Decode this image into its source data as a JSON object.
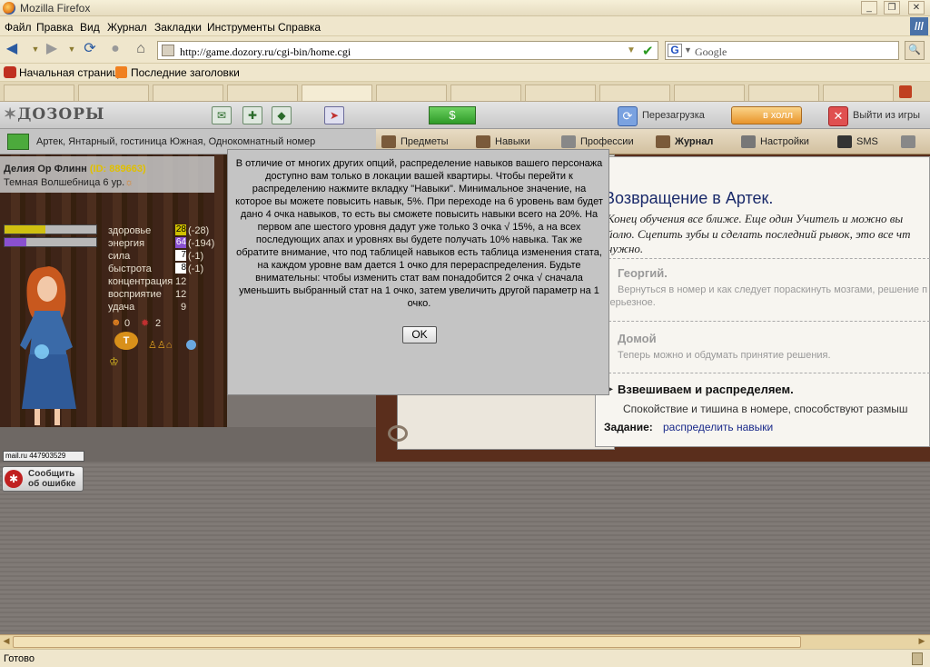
{
  "window": {
    "title": "Mozilla Firefox"
  },
  "menu": [
    "Файл",
    "Правка",
    "Вид",
    "Журнал",
    "Закладки",
    "Инструменты",
    "Справка"
  ],
  "navigation": {
    "url": "http://game.dozory.ru/cgi-bin/home.cgi",
    "search_engine": "Google"
  },
  "bookmarks": [
    "Начальная страница",
    "Последние заголовки"
  ],
  "game": {
    "logo": "ДОЗОРЫ",
    "reload_label": "Перезагрузка",
    "hall_label": "в холл",
    "exit_label": "Выйти из игры",
    "location": "Артек,  Янтарный, гостиница Южная, Однокомнатный номер",
    "tabs": [
      "Предметы",
      "Навыки",
      "Профессии",
      "Журнал",
      "Настройки",
      "SMS"
    ]
  },
  "character": {
    "name": "Делия Ор Флинн",
    "id": "(ID: 889663)",
    "class": "Темная Волшебница 6 ур.",
    "health_fraction": 0.45,
    "energy_fraction": 0.24,
    "stats": [
      {
        "label": "здоровье",
        "value": "28",
        "delta": "(-28)",
        "color": "#d0c000"
      },
      {
        "label": "энергия",
        "value": "64",
        "delta": "(-194)",
        "color": "#8a50d0"
      },
      {
        "label": "сила",
        "value": "7",
        "delta": "(-1)",
        "color": "#ffffff"
      },
      {
        "label": "быстрота",
        "value": "8",
        "delta": "(-1)",
        "color": "#ffffff"
      }
    ],
    "plain_stats": [
      {
        "label": "концентрация",
        "value": "12"
      },
      {
        "label": "восприятие",
        "value": "12"
      },
      {
        "label": "удача",
        "value": "9"
      }
    ],
    "counters": {
      "good": "0",
      "bad": "2"
    }
  },
  "mail_badge": "mail.ru 447903529",
  "report": {
    "line1": "Сообщить",
    "line2": "об ошибке"
  },
  "journal": {
    "title": "Возвращение в Артек.",
    "intro1": "Конец обучения все ближе. Еще один Учитель и можно вы",
    "intro2": "йолю. Сцепить зубы и сделать последний рывок, это все чт",
    "intro3": "нужно.",
    "entries": [
      {
        "head": "Георгий.",
        "text": "Вернуться в номер и как следует пораскинуть мозгами, решение п",
        "text2": "серьезное."
      },
      {
        "head": "Домой",
        "text": "Теперь можно и обдумать принятие решения."
      }
    ],
    "current": {
      "head": "Взвешиваем и распределяем.",
      "text": "Спокойствие и тишина в номере, способствуют размыш"
    },
    "task_label": "Задание:",
    "task_link": "распределить навыки"
  },
  "modal": {
    "text": "В отличие от многих других опций, распределение навыков вашего персонажа доступно вам только в локации вашей квартиры. Чтобы перейти к распределению нажмите вкладку \"Навыки\". Минимальное значение, на которое вы можете повысить навык, 5%. При переходе на 6 уровень вам будет дано 4 очка навыков, то есть вы сможете повысить навыки всего на 20%. На первом апе шестого уровня дадут уже только 3 очка √ 15%, а на всех последующих апах и уровнях вы будете получать 10% навыка. Так же обратите внимание, что под таблицей навыков есть таблица изменения стата, на каждом уровне вам дается 1 очко для перераспределения. Будьте внимательны: чтобы изменить стат вам понадобится 2 очка √ сначала уменьшить выбранный стат на 1 очко, затем увеличить другой параметр на 1 очко.",
    "ok": "OK"
  },
  "status": "Готово"
}
